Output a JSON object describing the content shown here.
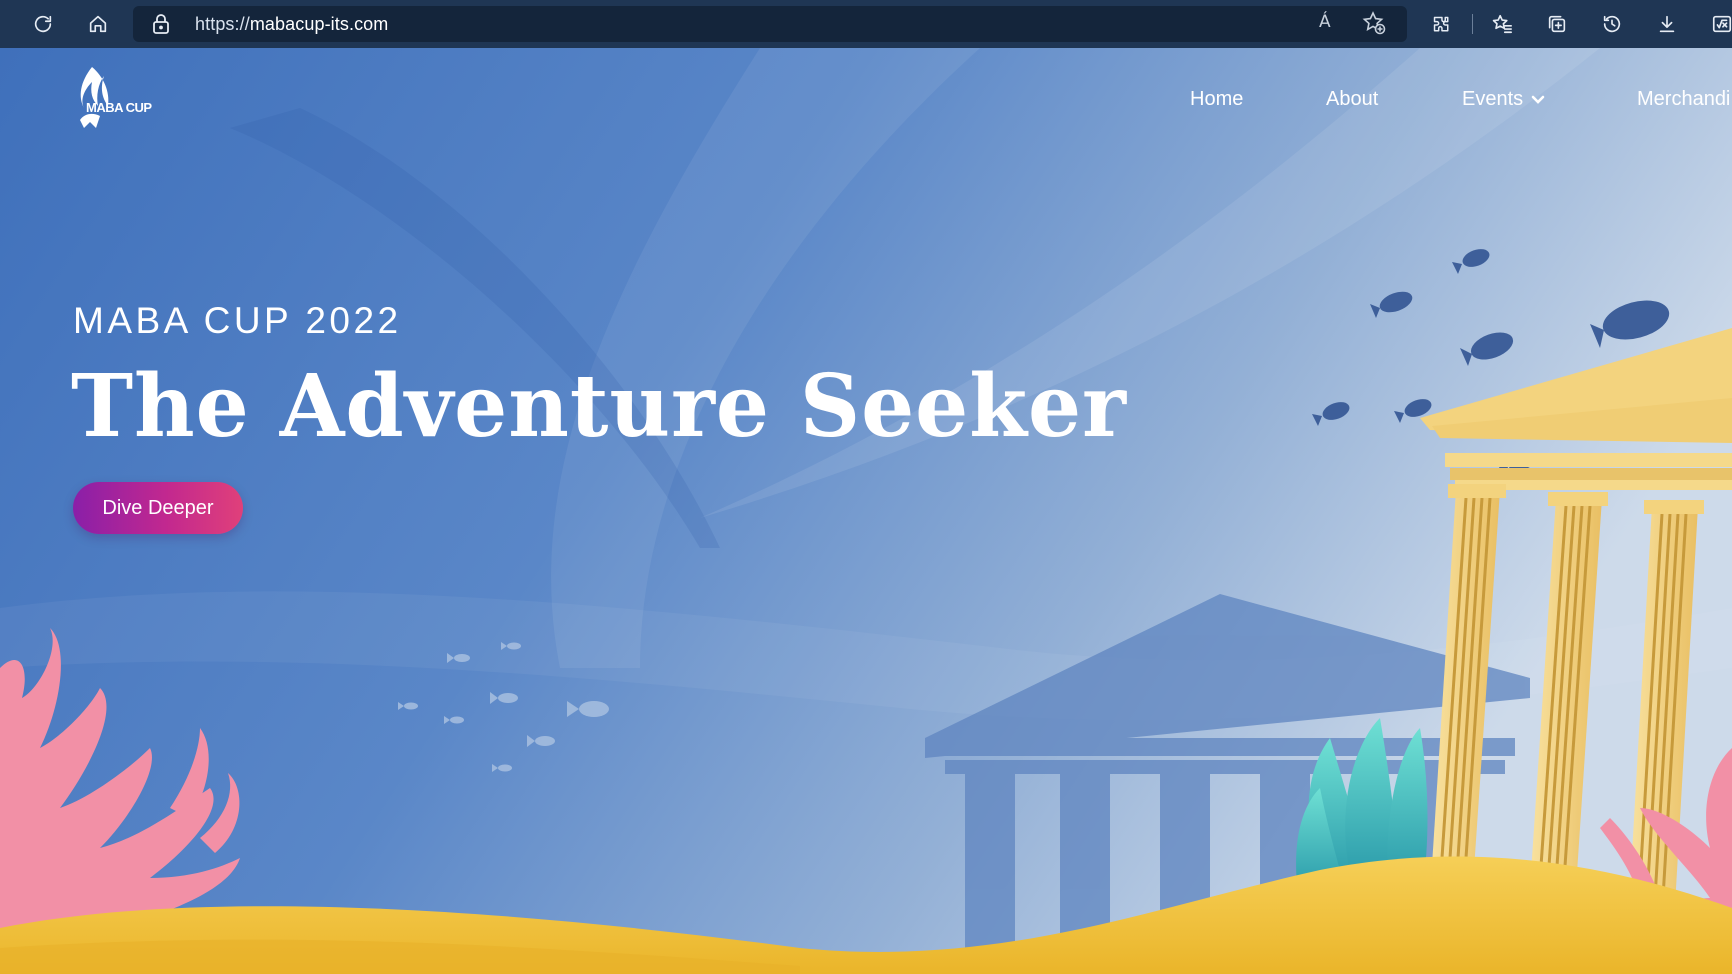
{
  "browser": {
    "url_scheme": "https://",
    "url_host": "mabacup-its.com",
    "read_aloud_glyph": "Á",
    "icons": [
      "refresh-icon",
      "home-icon",
      "lock-icon",
      "read-aloud-icon",
      "add-favorite-icon",
      "extensions-icon",
      "favorites-icon",
      "collections-icon",
      "history-icon",
      "downloads-icon",
      "math-solver-icon"
    ]
  },
  "site": {
    "logo_text": "MABA CUP",
    "nav": {
      "home": "Home",
      "about": "About",
      "events": "Events",
      "merchandise": "Merchandi"
    },
    "hero": {
      "eyebrow": "MABA CUP 2022",
      "title": "The Adventure Seeker",
      "cta": "Dive Deeper"
    }
  },
  "colors": {
    "chrome_bg": "#1f3654",
    "sea_top": "#4576be",
    "sea_light": "#c3d4e6",
    "sand": "#f2c23c",
    "coral": "#f08aa0",
    "seaweed": "#3cc4c0",
    "column": "#f7d88b",
    "cta_start": "#8a1fa8",
    "cta_end": "#e0407a"
  }
}
